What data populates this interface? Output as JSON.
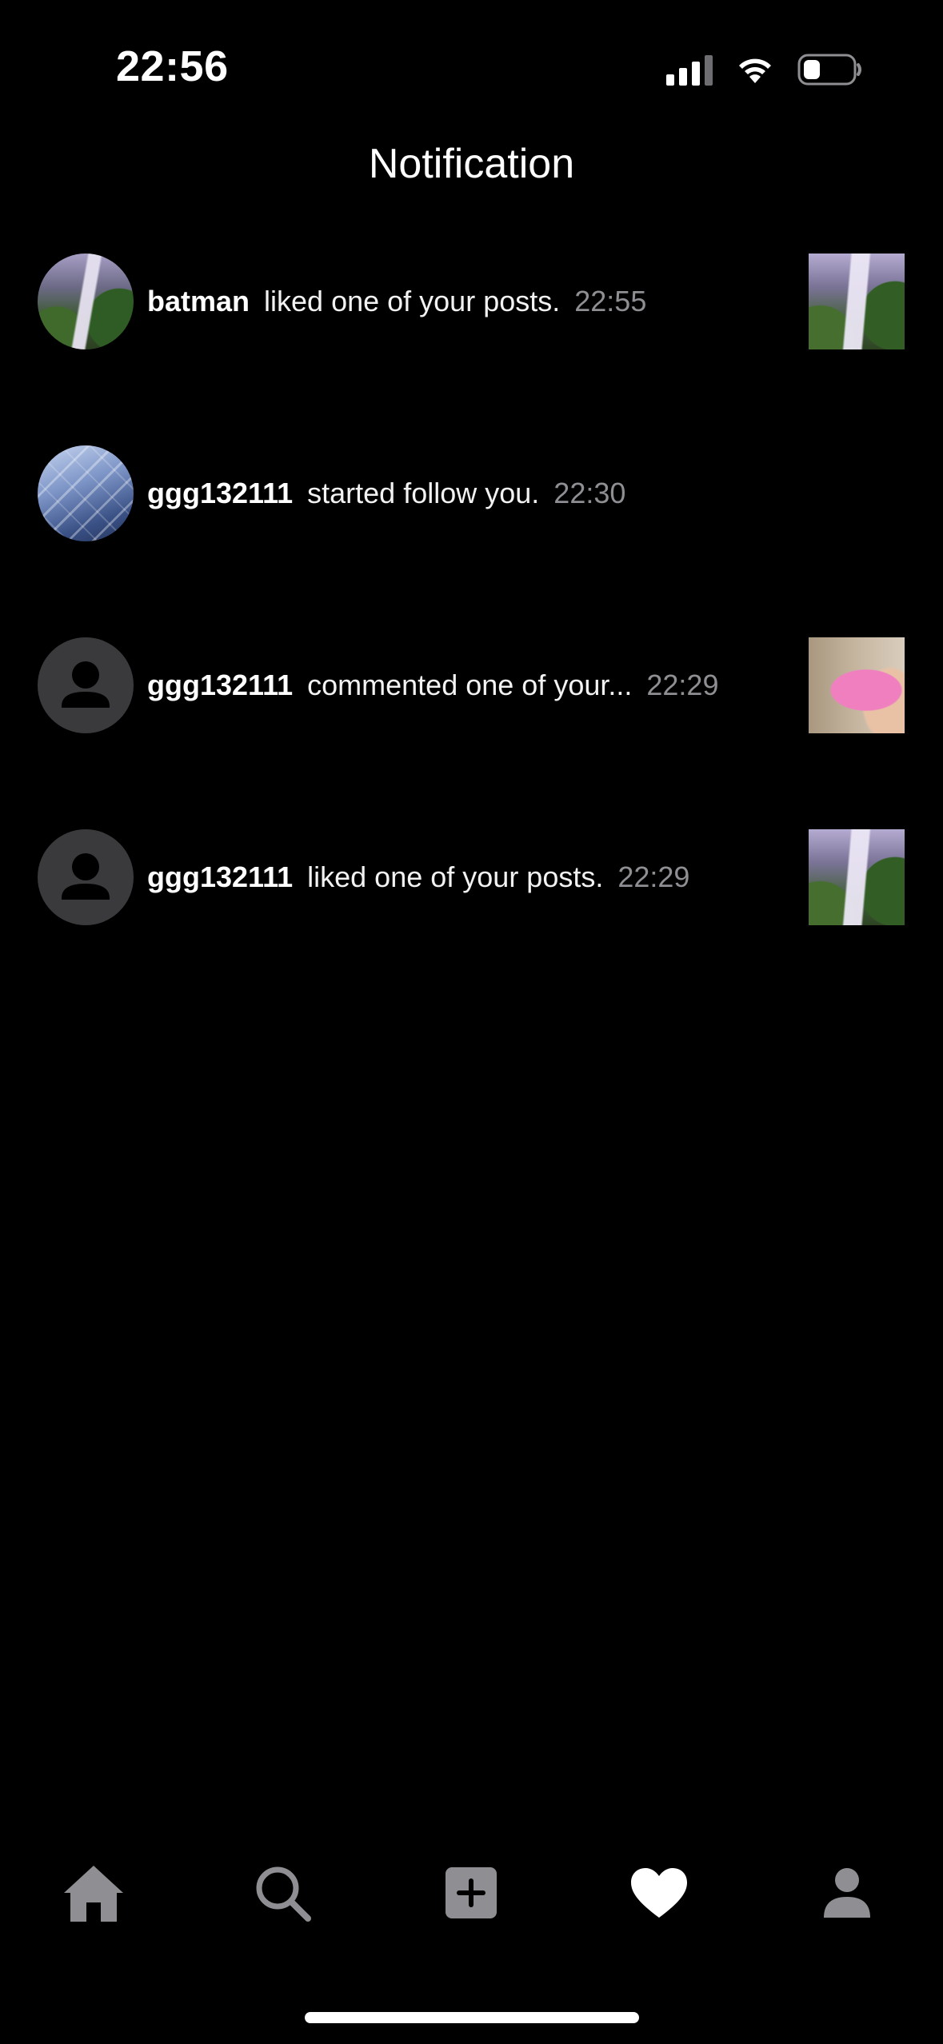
{
  "status_bar": {
    "time": "22:56",
    "icons": [
      "cellular-signal-icon",
      "wifi-icon",
      "battery-icon"
    ]
  },
  "header": {
    "title": "Notification"
  },
  "notifications": [
    {
      "user": "batman",
      "action": "liked one of your posts.",
      "time": "22:55",
      "avatar": "waterfall-photo",
      "thumbnail": "waterfall-photo"
    },
    {
      "user": "ggg132111",
      "action": "started follow you.",
      "time": "22:30",
      "avatar": "building-photo",
      "thumbnail": null
    },
    {
      "user": "ggg132111",
      "action": "commented one of your...",
      "time": "22:29",
      "avatar": "default-person",
      "thumbnail": "hand-pink-object-photo"
    },
    {
      "user": "ggg132111",
      "action": "liked one of your posts.",
      "time": "22:29",
      "avatar": "default-person",
      "thumbnail": "waterfall-photo"
    }
  ],
  "tab_bar": {
    "tabs": [
      {
        "icon": "home-icon",
        "active": false
      },
      {
        "icon": "search-icon",
        "active": false
      },
      {
        "icon": "add-post-icon",
        "active": false
      },
      {
        "icon": "heart-icon",
        "active": true
      },
      {
        "icon": "profile-icon",
        "active": false
      }
    ]
  },
  "colors": {
    "background": "#000000",
    "primary_text": "#ffffff",
    "secondary_text": "#8e8e93",
    "inactive_icon": "#8e8e93",
    "avatar_placeholder": "#3a3a3c"
  }
}
